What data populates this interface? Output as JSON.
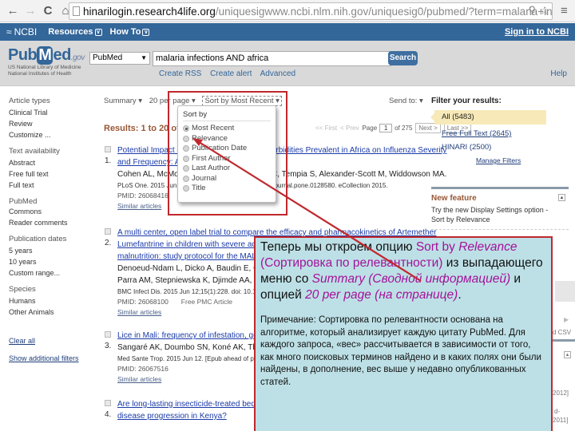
{
  "browser": {
    "url_host": "hinarilogin.research4life.org",
    "url_path": "/uniquesigwww.ncbi.nlm.nih.gov/uniquesig0/pubmed/?term=malaria+infections+AND-",
    "icons": {
      "back": "back-arrow-icon",
      "forward": "forward-arrow-icon",
      "reload": "reload-icon",
      "home": "home-icon",
      "search": "magnifier-icon",
      "bookmark": "star-icon",
      "menu": "menu-icon"
    }
  },
  "ncbi_bar": {
    "logo": "NCBI",
    "menus": [
      "Resources",
      "How To"
    ],
    "signin": "Sign in to NCBI"
  },
  "header": {
    "logo_pub": "Pub",
    "logo_m": "M",
    "logo_ed": "ed",
    "logo_gov": ".gov",
    "nlm_line1": "US National Library of Medicine",
    "nlm_line2": "National Institutes of Health",
    "database": "PubMed",
    "query": "malaria infections AND africa",
    "search_button": "Search",
    "links": [
      "Create RSS",
      "Create alert",
      "Advanced"
    ],
    "help": "Help"
  },
  "sidebar": {
    "groups": [
      {
        "heading": "Article types",
        "items": [
          "Clinical Trial",
          "Review",
          "Customize ..."
        ]
      },
      {
        "heading": "Text availability",
        "items": [
          "Abstract",
          "Free full text",
          "Full text"
        ]
      },
      {
        "heading": "PubMed",
        "items": [
          "Commons",
          "Reader comments"
        ]
      },
      {
        "heading": "Publication dates",
        "items": [
          "5 years",
          "10 years",
          "Custom range..."
        ]
      },
      {
        "heading": "Species",
        "items": [
          "Humans",
          "Other Animals"
        ]
      }
    ],
    "clear_all": "Clear all",
    "show_filters": "Show additional filters"
  },
  "toolbar": {
    "summary": "Summary ▾",
    "per_page": "20 per page ▾",
    "sort": "Sort by Most Recent ▾",
    "send_to": "Send to: ▾"
  },
  "results_header": {
    "title": "Results: 1 to 20 of 5483",
    "first": "<< First",
    "prev": "< Prev",
    "page_label": "Page",
    "page_value": "1",
    "of_label": "of 275",
    "next": "Next >",
    "last": "Last >>"
  },
  "sort_dropdown": {
    "heading": "Sort by",
    "selected": "Most Recent",
    "options": [
      "Most Recent",
      "Relevance",
      "Publication Date",
      "First Author",
      "Last Author",
      "Journal",
      "Title"
    ]
  },
  "results": [
    {
      "num": "1.",
      "title_lines": [
        "Potential Impact of Host Immunity and Comorbidities Prevalent in Africa on Influenza Severity",
        "and Frequency: A Systematic Review."
      ],
      "authors": "Cohen AL, McMorrow M, Walaza S, Cohen C, Tempia S, Alexander-Scott M, Widdowson MA.",
      "journal": "PLoS One. 2015 Jun 12;10(6):e0128580. doi: 10.1371/journal.pone.0128580. eCollection 2015.",
      "pmid": "PMID: 26068416",
      "extra": "Free PMC Article",
      "similar": "Similar articles"
    },
    {
      "num": "2.",
      "title_lines": [
        "A multi center, open label trial to compare the efficacy and pharmacokinetics of Artemether",
        "Lumefantrine in children with severe acute",
        "malnutrition: study protocol for the MAL-N"
      ],
      "authors_lines": [
        "Denoeud-Ndam L, Dicko A, Baudin E, Guin",
        "Parra AM, Stepniewska K, Djimde AA, Bam"
      ],
      "journal": "BMC Infect Dis. 2015 Jun 12;15(1):228. doi: 10.11",
      "pmid": "PMID: 26068100",
      "extra": "Free PMC Article",
      "similar": "Similar articles"
    },
    {
      "num": "3.",
      "title_lines": [
        "Lice in Mali: frequency of infestation, geno"
      ],
      "authors": "Sangaré AK, Doumbo SN, Koné AK, Thera",
      "journal": "Med Sante Trop. 2015 Jun 12. [Epub ahead of print]",
      "pmid": "PMID: 26067516",
      "extra": "",
      "similar": "Similar articles"
    },
    {
      "num": "4.",
      "title_lines": [
        "Are long-lasting insecticide-treated bednet",
        "disease progression in Kenya?"
      ],
      "authors": "",
      "journal": "",
      "pmid": "",
      "extra": "",
      "similar": ""
    }
  ],
  "filters": {
    "heading": "Filter your results:",
    "selected": "All (5483)",
    "options": [
      "Free Full Text (2645)",
      "HINARI (2500)"
    ],
    "manage": "Manage Filters"
  },
  "new_feature": {
    "heading": "New feature",
    "text_line1": "Try the new Display Settings option -",
    "text_line2": "Sort by Relevance"
  },
  "edge_fragments": {
    "csv": "d CSV",
    "year1": "2012]",
    "dash": "d-",
    "year2": "2011]"
  },
  "callout": {
    "p1_a": "Теперь мы откроем опцию ",
    "p1_sort": "Sort by",
    "p1_relevance": "Relevance",
    "p1_b": " (Сортировка по релевантности)",
    "p1_c": " из выпадающего меню со ",
    "p1_summary": "Summary",
    "p1_d": "(Сводной информацией)",
    "p1_e": " и опцией ",
    "p1_per": "20 per page (на странице)",
    "p1_f": ".",
    "note": "Примечание:  Сортировка по релевантности основана на алгоритме, который анализирует каждую цитату PubMed.  Для каждого запроса, «вес» рассчитывается в зависимости от того, как много поисковых терминов найдено и в каких полях они были найдены, в дополнение, вес выше у недавно опубликованных статей."
  },
  "colors": {
    "ncbi_blue": "#336699",
    "annotation_red": "#c0282d",
    "callout_bg": "#bde0e6",
    "highlight_magenta": "#a3139a",
    "results_brown": "#985735",
    "filter_selected": "#f7e9b8"
  }
}
